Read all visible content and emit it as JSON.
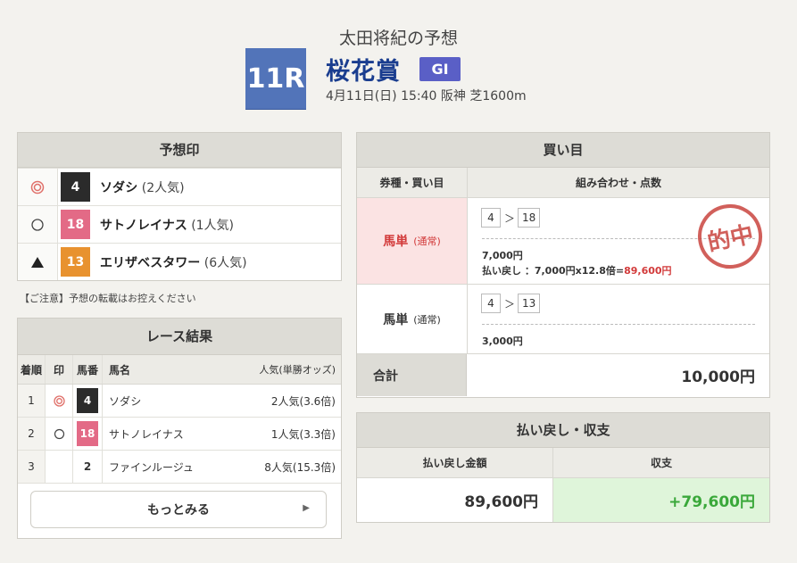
{
  "header": {
    "title": "太田将紀の予想",
    "race_number": "11R",
    "race_name": "桜花賞",
    "grade": "GI",
    "race_info": "4月11日(日) 15:40 阪神 芝1600m"
  },
  "prediction": {
    "heading": "予想印",
    "rows": [
      {
        "mark": "◎",
        "horse_no": "4",
        "horse_name": "ソダシ",
        "popularity": "(2人気)",
        "box_color": "#2b2b2b"
      },
      {
        "mark": "○",
        "horse_no": "18",
        "horse_name": "サトノレイナス",
        "popularity": "(1人気)",
        "box_color": "#e36a86"
      },
      {
        "mark": "▲",
        "horse_no": "13",
        "horse_name": "エリザベスタワー",
        "popularity": "(6人気)",
        "box_color": "#e8922f"
      }
    ],
    "notice": "【ご注意】予想の転載はお控えください"
  },
  "results": {
    "heading": "レース結果",
    "columns": [
      "着順",
      "印",
      "馬番",
      "馬名",
      "人気(単勝オッズ)"
    ],
    "rows": [
      {
        "rank": "1",
        "mark": "◎",
        "horse_no": "4",
        "horse_name": "ソダシ",
        "popularity": "2人気(3.6倍)",
        "box_color": "#2b2b2b"
      },
      {
        "rank": "2",
        "mark": "○",
        "horse_no": "18",
        "horse_name": "サトノレイナス",
        "popularity": "1人気(3.3倍)",
        "box_color": "#e36a86"
      },
      {
        "rank": "3",
        "mark": "",
        "horse_no": "2",
        "horse_name": "ファインルージュ",
        "popularity": "8人気(15.3倍)",
        "box_color": ""
      }
    ],
    "more_label": "もっとみる"
  },
  "buy": {
    "heading": "買い目",
    "col_type": "券種・買い目",
    "col_combo": "組み合わせ・点数",
    "bets": [
      {
        "type": "馬単",
        "sub": "(通常)",
        "first": "4",
        "arrow": "＞",
        "second": "18",
        "amount": "7,000円",
        "refund_prefix": "払い戻し ：7,000円x12.8倍=",
        "refund_value": "89,600円",
        "hit": true,
        "stamp": "的中"
      },
      {
        "type": "馬単",
        "sub": "(通常)",
        "first": "4",
        "arrow": "＞",
        "second": "13",
        "amount": "3,000円",
        "hit": false
      }
    ],
    "total_label": "合計",
    "total_value": "10,000円"
  },
  "payout": {
    "heading": "払い戻し・収支",
    "col_refund": "払い戻し金額",
    "col_balance": "収支",
    "refund_value": "89,600円",
    "balance_value": "+79,600円"
  },
  "colors": {
    "race_number_bg": "#5274b9",
    "grade_bg": "#5a5fc6",
    "race_name": "#1a3d8f",
    "hit_row_bg": "#fbe3e3",
    "hit_text": "#d23a3a",
    "balance_bg": "#dff5da",
    "balance_text": "#3aa83a"
  }
}
